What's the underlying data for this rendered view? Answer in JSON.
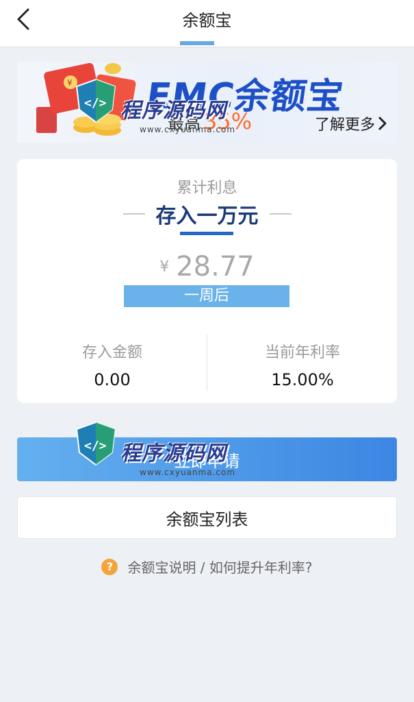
{
  "header": {
    "title": "余额宝"
  },
  "banner": {
    "title": "EMC余额宝",
    "subtitle_prefix": "最高",
    "subtitle_percent": "35%",
    "learn_more": "了解更多"
  },
  "interest_card": {
    "label": "累计利息",
    "title": "存入一万元",
    "currency": "¥",
    "amount": "28.77",
    "period": "一周后",
    "deposit_label": "存入金额",
    "deposit_value": "0.00",
    "rate_label": "当前年利率",
    "rate_value": "15.00%"
  },
  "actions": {
    "apply_label": "立即申请",
    "list_label": "余额宝列表"
  },
  "help": {
    "icon": "?",
    "text": "余额宝说明 / 如何提升年利率?"
  },
  "watermark": {
    "text": "程序源码网",
    "url": "www.cxyuanma.com"
  },
  "colors": {
    "accent": "#3d86e3",
    "banner_title": "#1d4fc7",
    "highlight": "#ff6a2a",
    "help_icon": "#f3a53b"
  }
}
